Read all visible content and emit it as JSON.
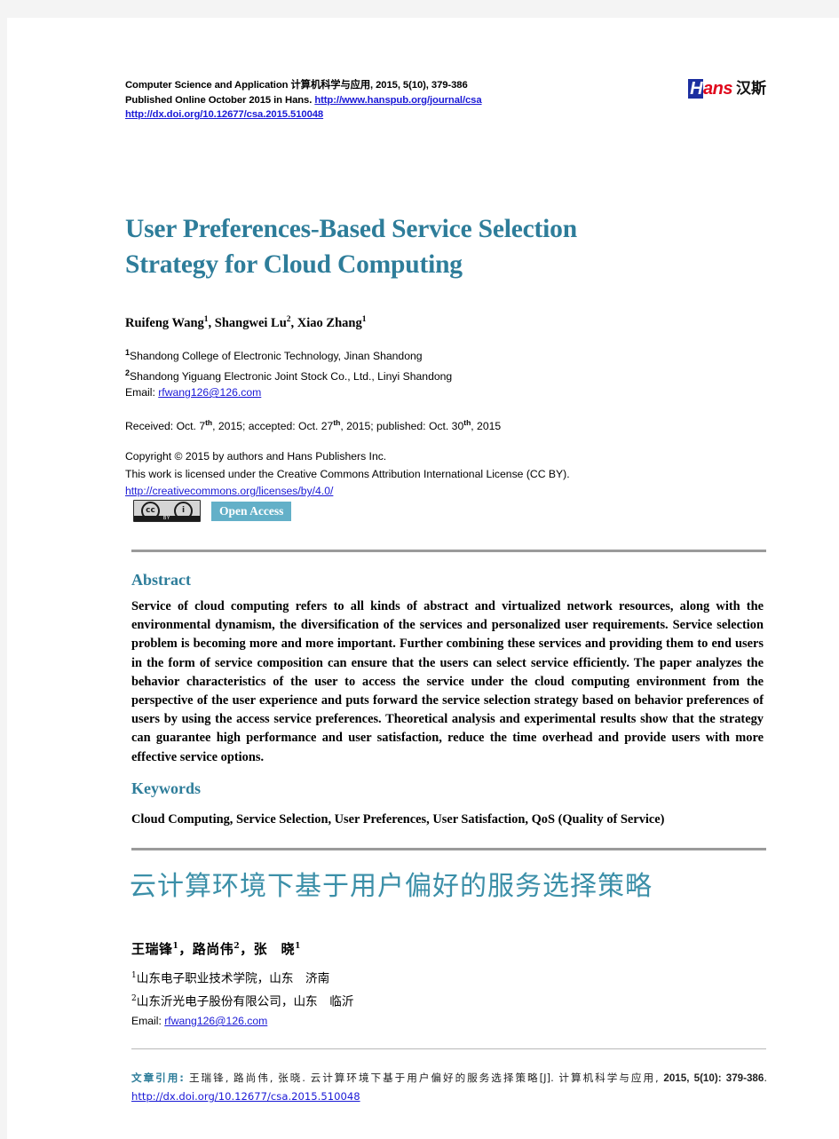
{
  "masthead": {
    "line1": "Computer Science and Application  计算机科学与应用, 2015, 5(10), 379-386",
    "line2_prefix": "Published Online October 2015 in Hans. ",
    "line2_link": "http://www.hanspub.org/journal/csa",
    "line3_link": "http://dx.doi.org/10.12677/csa.2015.510048",
    "logo_h": "H",
    "logo_ans": "ans",
    "logo_cn": "汉斯"
  },
  "title": {
    "en_line1": "User Preferences-Based Service Selection",
    "en_line2": "Strategy for Cloud Computing",
    "cn": "云计算环境下基于用户偏好的服务选择策略"
  },
  "authors": {
    "en": "Ruifeng Wang1, Shangwei Lu2, Xiao Zhang1",
    "en_parts": [
      {
        "name": "Ruifeng Wang",
        "sup": "1"
      },
      {
        "name": "Shangwei Lu",
        "sup": "2"
      },
      {
        "name": "Xiao Zhang",
        "sup": "1"
      }
    ],
    "cn_parts": [
      {
        "name": "王瑞锋",
        "sup": "1"
      },
      {
        "name": "路尚伟",
        "sup": "2"
      },
      {
        "name": "张　晓",
        "sup": "1"
      }
    ],
    "affiliations_en": [
      {
        "sup": "1",
        "text": "Shandong College of Electronic Technology, Jinan Shandong"
      },
      {
        "sup": "2",
        "text": "Shandong Yiguang Electronic Joint Stock Co., Ltd., Linyi Shandong"
      }
    ],
    "affiliations_cn": [
      {
        "sup": "1",
        "text": "山东电子职业技术学院，山东　济南"
      },
      {
        "sup": "2",
        "text": "山东沂光电子股份有限公司，山东　临沂"
      }
    ],
    "email_label": "Email: ",
    "email": "rfwang126@126.com"
  },
  "dates": {
    "received_label": "Received: Oct. 7",
    "received_sup": "th",
    "received_rest": ", 2015; accepted: Oct. 27",
    "accepted_sup": "th",
    "accepted_rest": ", 2015; published: Oct. 30",
    "published_sup": "th",
    "published_rest": ", 2015"
  },
  "copyright": {
    "line1": "Copyright © 2015 by authors and Hans Publishers Inc.",
    "line2": "This work is licensed under the Creative Commons Attribution International License (CC BY).",
    "license_link": "http://creativecommons.org/licenses/by/4.0/"
  },
  "badges": {
    "cc_mark": "cc",
    "cc_person": "i",
    "cc_by": "BY",
    "open_access": "Open Access"
  },
  "sections": {
    "abstract_heading": "Abstract",
    "abstract_body": "Service of cloud computing refers to all kinds of abstract and virtualized network resources, along with the environmental dynamism, the diversification of the services and personalized user requirements. Service selection problem is becoming more and more important. Further combining these services and providing them to end users in the form of service composition can ensure that the users can select service efficiently. The paper analyzes the behavior characteristics of the user to access the service under the cloud computing environment from the perspective of the user experience and puts forward the service selection strategy based on behavior preferences of users by using the access service preferences. Theoretical analysis and experimental results show that the strategy can guarantee high performance and user satisfaction, reduce the time overhead and provide users with more effective service options.",
    "keywords_heading": "Keywords",
    "keywords_body": "Cloud Computing, Service Selection, User Preferences, User Satisfaction, QoS (Quality of Service)"
  },
  "citation": {
    "label": "文章引用: ",
    "text_cn": "王瑞锋, 路尚伟, 张晓. 云计算环境下基于用户偏好的服务选择策略[J]. 计算机科学与应用, ",
    "volume": "2015, 5(10): 379-386",
    "separator": ". ",
    "doi_link": "http://dx.doi.org/10.12677/csa.2015.510048"
  },
  "colors": {
    "accent_teal": "#2e7d9a",
    "title_cn_teal": "#3b8fa8",
    "link_blue": "#1a19d6",
    "open_access_bg": "#63b0c8",
    "rule_gray": "#9a9a9a",
    "logo_blue": "#1c2fa0",
    "logo_red": "#e0081c",
    "page_bg": "#f4f4f4"
  }
}
